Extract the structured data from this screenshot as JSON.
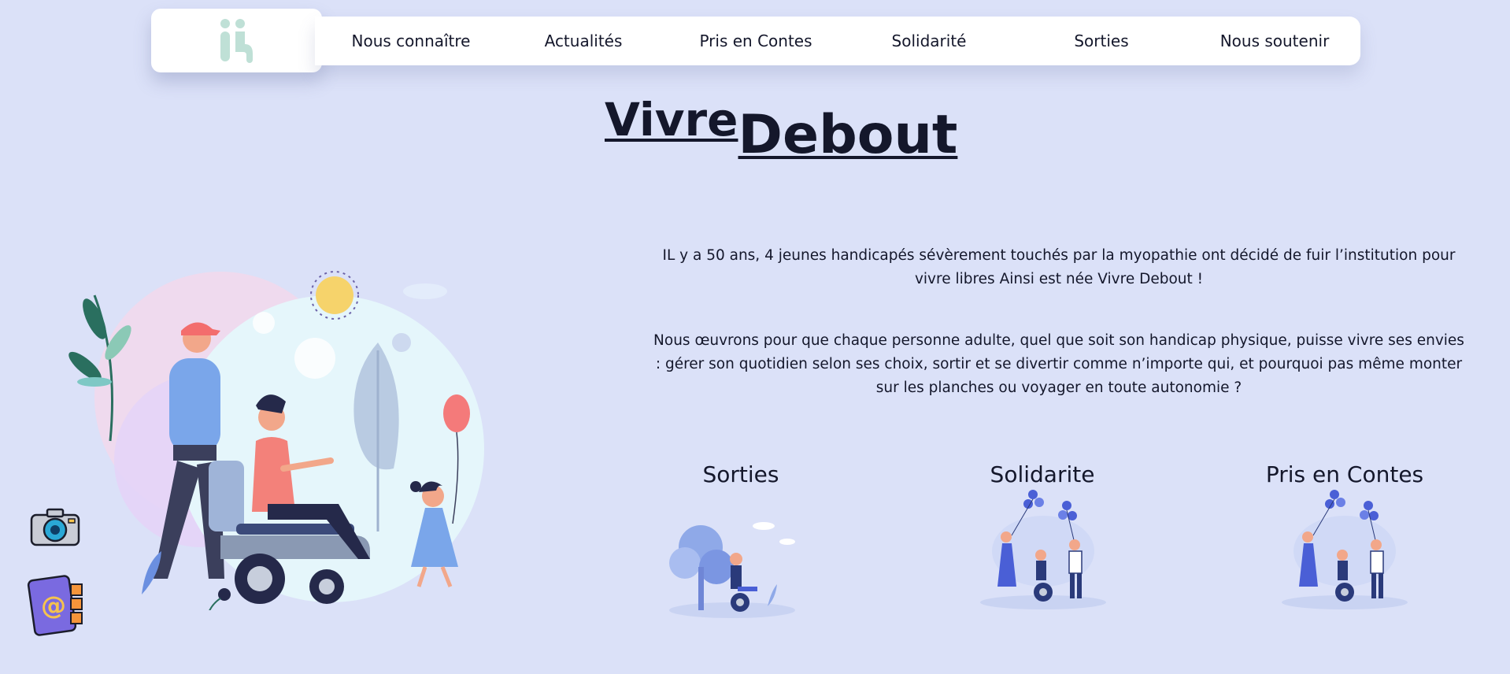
{
  "nav": {
    "logo_icon": "vivre-debout-logo",
    "items": [
      {
        "label": "Nous connaître"
      },
      {
        "label": "Actualités"
      },
      {
        "label": "Pris en Contes"
      },
      {
        "label": "Solidarité"
      },
      {
        "label": "Sorties"
      },
      {
        "label": "Nous soutenir"
      }
    ]
  },
  "brand": {
    "word1": "Vivre",
    "word2": "Debout"
  },
  "intro": {
    "p1": "IL y a 50 ans, 4 jeunes handicapés sévèrement touchés par la myopathie ont décidé de fuir l’institution pour vivre libres Ainsi est née Vivre Debout !",
    "p2": "Nous œuvrons pour que chaque personne adulte, quel que soit son handicap physique, puisse vivre ses envies : gérer son quotidien selon ses choix, sortir et se divertir comme n’importe qui, et pourquoi pas même monter sur les planches ou voyager en toute autonomie ?"
  },
  "cards": [
    {
      "title": "Sorties",
      "icon": "outing-illustration"
    },
    {
      "title": "Solidarite",
      "icon": "solidarity-illustration"
    },
    {
      "title": "Pris en Contes",
      "icon": "storytelling-illustration"
    }
  ],
  "side_icons": [
    "camera-icon",
    "contact-book-icon"
  ],
  "colors": {
    "background": "#dbe1f8",
    "accent_blue": "#4a5fd6",
    "logo_green": "#bfe0d6"
  }
}
